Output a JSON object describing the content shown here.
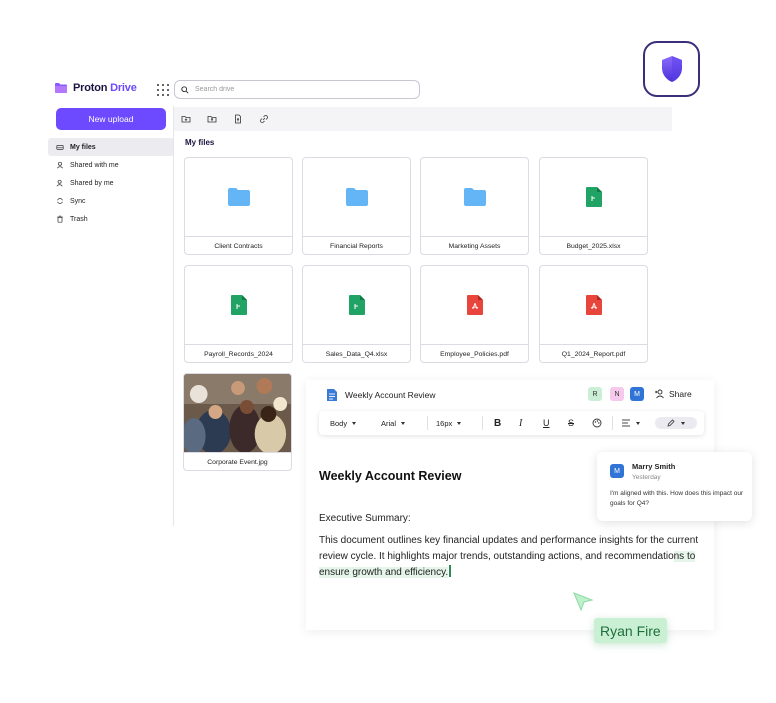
{
  "app": {
    "brand_first": "Proton",
    "brand_second": "Drive",
    "accent_color": "#6d4aff"
  },
  "search": {
    "placeholder": "Search drive"
  },
  "sidebar": {
    "new_upload_label": "New upload",
    "items": [
      {
        "label": "My files",
        "icon": "hard-drive-icon",
        "active": true
      },
      {
        "label": "Shared with me",
        "icon": "user-icon"
      },
      {
        "label": "Shared by me",
        "icon": "user-share-icon"
      },
      {
        "label": "Sync",
        "icon": "sync-icon"
      },
      {
        "label": "Trash",
        "icon": "trash-icon"
      }
    ]
  },
  "toolbar": {
    "icons": [
      "new-folder-icon",
      "upload-folder-icon",
      "upload-file-icon",
      "link-icon"
    ]
  },
  "main": {
    "section_title": "My files",
    "files": [
      {
        "name": "Client Contracts",
        "type": "folder"
      },
      {
        "name": "Financial Reports",
        "type": "folder"
      },
      {
        "name": "Marketing Assets",
        "type": "folder"
      },
      {
        "name": "Budget_2025.xlsx",
        "type": "spreadsheet"
      },
      {
        "name": "Payroll_Records_2024",
        "type": "spreadsheet"
      },
      {
        "name": "Sales_Data_Q4.xlsx",
        "type": "spreadsheet"
      },
      {
        "name": "Employee_Policies.pdf",
        "type": "pdf"
      },
      {
        "name": "Q1_2024_Report.pdf",
        "type": "pdf"
      },
      {
        "name": "Corporate Event.jpg",
        "type": "image"
      }
    ]
  },
  "editor": {
    "doc_title": "Weekly Account Review",
    "collaborators": [
      "R",
      "N",
      "M"
    ],
    "share_label": "Share",
    "format": {
      "style": "Body",
      "font": "Arial",
      "size": "16px",
      "bold": "B",
      "italic": "I",
      "underline": "U",
      "strike": "S"
    },
    "heading": "Weekly Account Review",
    "subheading": "Executive Summary:",
    "body_part1": "This document outlines key financial updates and performance insights for the current review cycle. It highlights major trends, outstanding actions, and recommendatio",
    "body_highlight": "ns to ensure growth and efficiency."
  },
  "comment": {
    "initial": "M",
    "author": "Marry Smith",
    "time": "Yesterday",
    "text": "I'm aligned with this. How does this impact our goals for Q4?"
  },
  "collaborator_cursor": {
    "name": "Ryan Fire",
    "color": "#c9f0d3"
  }
}
